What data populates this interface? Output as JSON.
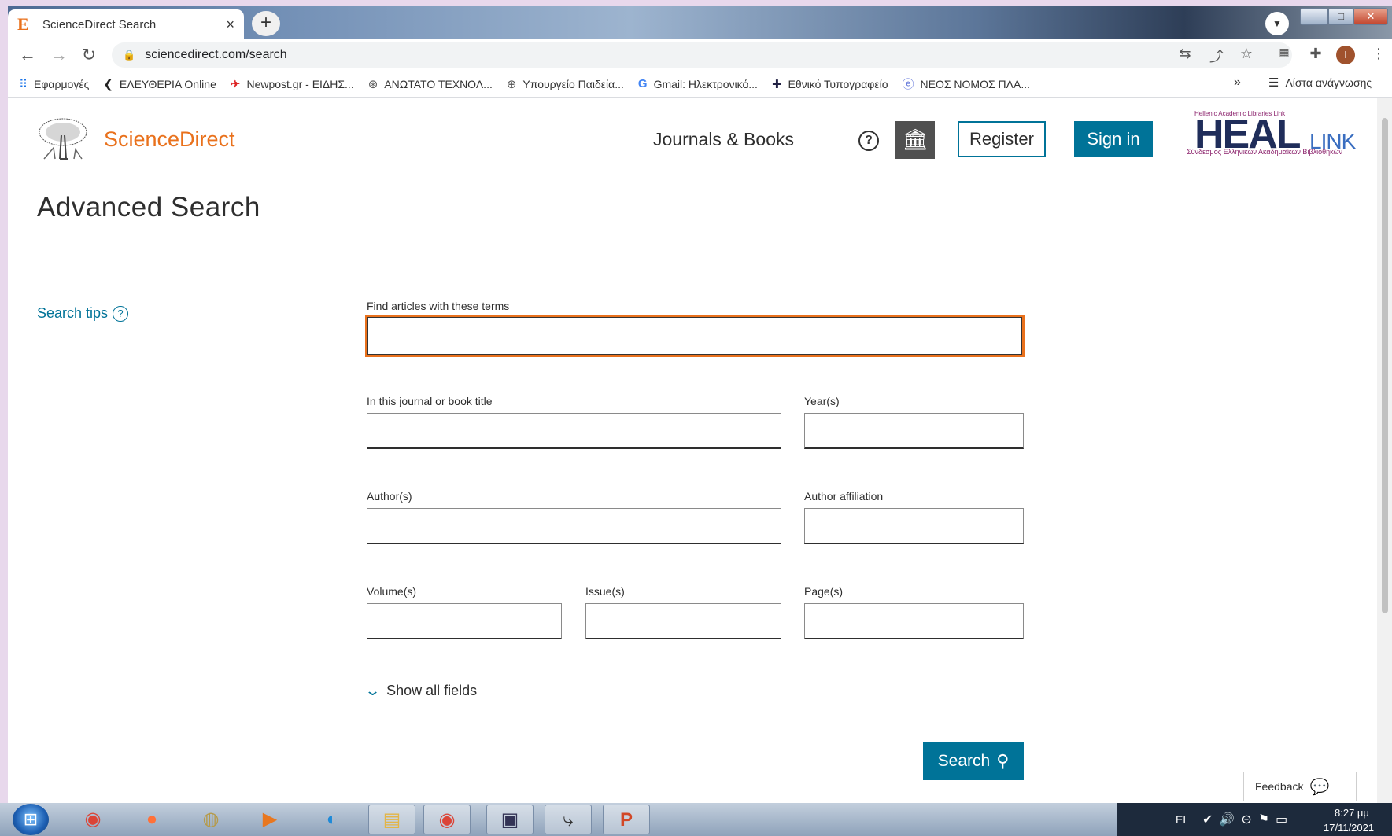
{
  "browser": {
    "tab_title": "ScienceDirect Search",
    "tab_favicon": "E",
    "tab_close": "×",
    "new_tab": "+",
    "url": "sciencedirect.com/search",
    "window_controls": {
      "minimize": "–",
      "maximize": "□",
      "close": "✕"
    },
    "avatar_letter": "I",
    "bookmarks": [
      {
        "icon": "apps-grid-icon",
        "label": "Εφαρμογές"
      },
      {
        "icon": "arrow-logo-icon",
        "label": "ΕΛΕΥΘΕΡΙΑ Online"
      },
      {
        "icon": "newpost-logo-icon",
        "label": "Newpost.gr - ΕΙΔΗΣ..."
      },
      {
        "icon": "university-seal-icon",
        "label": "ΑΝΩΤΑΤΟ ΤΕΧΝΟΛ..."
      },
      {
        "icon": "ministry-seal-icon",
        "label": "Υπουργείο Παιδεία..."
      },
      {
        "icon": "google-icon",
        "label": "Gmail: Ηλεκτρονικό..."
      },
      {
        "icon": "national-press-icon",
        "label": "Εθνικό Τυπογραφείο"
      },
      {
        "icon": "edge-icon",
        "label": "ΝΕΟΣ ΝΟΜΟΣ ΠΛΑ..."
      }
    ],
    "bookmarks_overflow": "»",
    "reading_list": "Λίστα ανάγνωσης"
  },
  "header": {
    "brand": "ScienceDirect",
    "nav_journals": "Journals & Books",
    "help": "?",
    "register": "Register",
    "sign_in": "Sign in",
    "heal_small": "Hellenic Academic Libraries Link",
    "heal_main": "HEAL",
    "heal_link": "LINK",
    "heal_sub": "Σύνδεσμος Ελληνικών Ακαδημαϊκών Βιβλιοθηκών"
  },
  "page": {
    "title": "Advanced Search",
    "search_tips": "Search tips",
    "search_tips_icon": "?"
  },
  "form": {
    "terms_label": "Find articles with these terms",
    "terms_value": "",
    "journal_label": "In this journal or book title",
    "journal_value": "",
    "years_label": "Year(s)",
    "years_value": "",
    "authors_label": "Author(s)",
    "authors_value": "",
    "affiliation_label": "Author affiliation",
    "affiliation_value": "",
    "volume_label": "Volume(s)",
    "volume_value": "",
    "issue_label": "Issue(s)",
    "issue_value": "",
    "pages_label": "Page(s)",
    "pages_value": "",
    "show_all": "Show all fields",
    "search_button": "Search"
  },
  "feedback": "Feedback",
  "taskbar": {
    "apps": [
      "start-icon",
      "chrome-icon",
      "firefox-icon",
      "app-icon",
      "media-player-icon",
      "edge-icon",
      "file-explorer-icon",
      "chrome-icon",
      "network-app-icon",
      "shortcut-app-icon",
      "powerpoint-icon"
    ],
    "language": "EL",
    "time": "8:27 μμ",
    "date": "17/11/2021"
  },
  "colors": {
    "brand_orange": "#e9711c",
    "accent_blue": "#007398",
    "institution_grey": "#505050"
  }
}
